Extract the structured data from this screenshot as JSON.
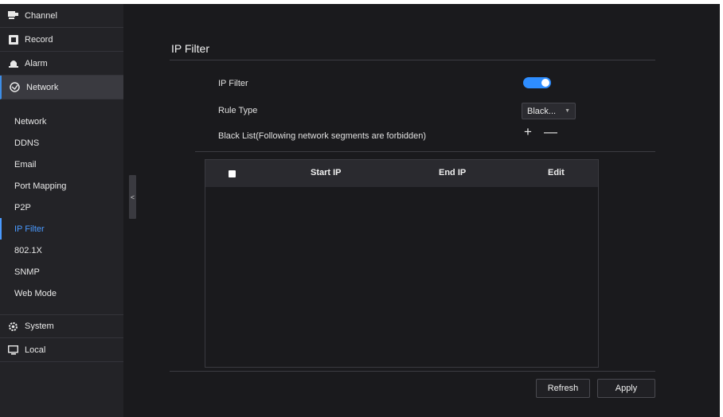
{
  "sidebar": {
    "sections": {
      "channel": "Channel",
      "record": "Record",
      "alarm": "Alarm",
      "network": "Network",
      "system": "System",
      "local": "Local"
    },
    "network_items": [
      "Network",
      "DDNS",
      "Email",
      "Port Mapping",
      "P2P",
      "IP Filter",
      "802.1X",
      "SNMP",
      "Web Mode"
    ],
    "active_item": "IP Filter",
    "collapse_glyph": "<"
  },
  "main": {
    "title": "IP Filter",
    "ip_filter_label": "IP Filter",
    "ip_filter_enabled": true,
    "rule_type_label": "Rule Type",
    "rule_type_value": "Black...",
    "black_list_label": "Black List(Following network segments are forbidden)",
    "add_glyph": "+",
    "remove_glyph": "—",
    "table": {
      "columns": [
        "Start IP",
        "End IP",
        "Edit"
      ],
      "rows": []
    },
    "refresh_label": "Refresh",
    "apply_label": "Apply"
  },
  "colors": {
    "accent": "#2e8dff",
    "active_link": "#4a9aff",
    "background": "#1a1a1d",
    "sidebar": "#232327"
  }
}
